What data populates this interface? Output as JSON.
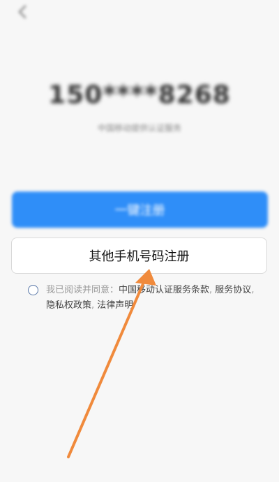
{
  "header": {
    "back_icon": "chevron-left-icon"
  },
  "phone": {
    "masked_number": "150****8268",
    "carrier_note": "中国移动提供认证服务"
  },
  "buttons": {
    "one_click_label": "一键注册",
    "other_phone_label": "其他手机号码注册"
  },
  "agreement": {
    "prefix": "我已阅读并同意：",
    "links": [
      "中国移动认证服务条款",
      "服务协议",
      "隐私权政策",
      "法律声明"
    ]
  },
  "colors": {
    "primary": "#2f8ef8",
    "annotation_arrow": "#f08a3c"
  }
}
